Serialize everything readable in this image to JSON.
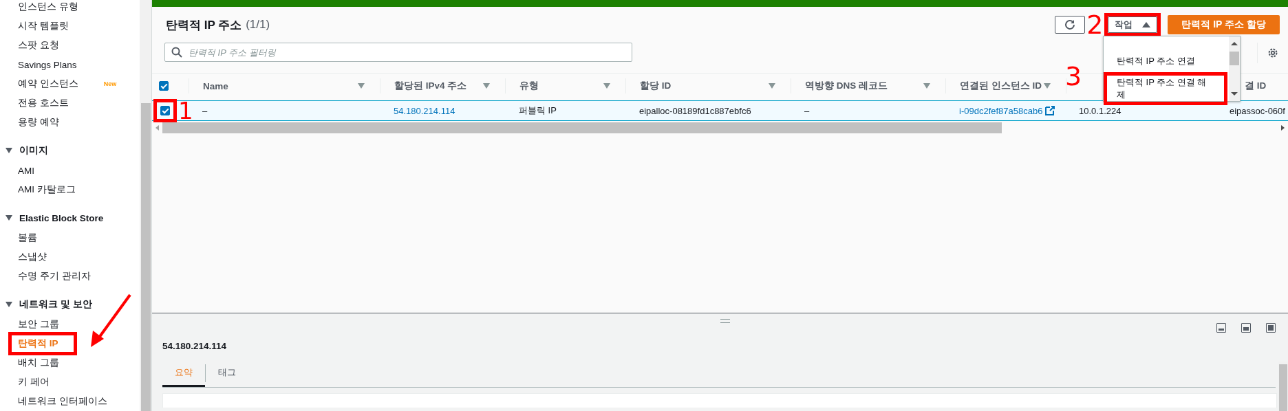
{
  "sidebar": {
    "sections": [
      {
        "items": [
          {
            "label": "인스턴스 유형",
            "selected": false
          },
          {
            "label": "시작 템플릿",
            "selected": false
          },
          {
            "label": "스팟 요청",
            "selected": false
          },
          {
            "label": "Savings Plans",
            "selected": false
          },
          {
            "label": "예약 인스턴스",
            "selected": false,
            "badge": "New"
          },
          {
            "label": "전용 호스트",
            "selected": false
          },
          {
            "label": "용량 예약",
            "selected": false
          }
        ]
      },
      {
        "title": "이미지",
        "expanded": true,
        "items": [
          {
            "label": "AMI",
            "selected": false
          },
          {
            "label": "AMI 카탈로그",
            "selected": false
          }
        ]
      },
      {
        "title": "Elastic Block Store",
        "expanded": true,
        "items": [
          {
            "label": "볼륨",
            "selected": false
          },
          {
            "label": "스냅샷",
            "selected": false
          },
          {
            "label": "수명 주기 관리자",
            "selected": false
          }
        ]
      },
      {
        "title": "네트워크 및 보안",
        "expanded": true,
        "items": [
          {
            "label": "보안 그룹",
            "selected": false
          },
          {
            "label": "탄력적 IP",
            "selected": true,
            "highlighted": true,
            "arrow": true
          },
          {
            "label": "배치 그룹",
            "selected": false
          },
          {
            "label": "키 페어",
            "selected": false
          },
          {
            "label": "네트워크 인터페이스",
            "selected": false
          }
        ]
      }
    ]
  },
  "table_panel": {
    "title": "탄력적 IP 주소",
    "count": "(1/1)",
    "actions_button": {
      "label": "작업",
      "expanded": true,
      "highlighted": true,
      "annotation": "2"
    },
    "primary_button": "탄력적 IP 주소 할당",
    "actions_menu": [
      {
        "label": "탄력적 IP 주소 연결",
        "highlighted": false
      },
      {
        "label": "탄력적 IP 주소 연결 해제",
        "highlighted": true,
        "annotation": "3"
      }
    ],
    "filter": {
      "placeholder": "탄력적 IP 주소 필터링"
    },
    "select_all_checked": true,
    "columns": [
      {
        "label": "Name",
        "sortable": true
      },
      {
        "label": "할당된 IPv4 주소",
        "sortable": true
      },
      {
        "label": "유형",
        "sortable": true
      },
      {
        "label": "할당 ID",
        "sortable": true
      },
      {
        "label": "역방향 DNS 레코드",
        "sortable": true
      },
      {
        "label": "연결된 인스턴스 ID",
        "sortable": true
      },
      {
        "sortable": false
      },
      {
        "label": "결 ID",
        "sortable": false
      }
    ],
    "rows": [
      {
        "checked": true,
        "selected": true,
        "highlighted": true,
        "annotation": "1",
        "cells": [
          {
            "text": "–",
            "kind": "text"
          },
          {
            "text": "54.180.214.114",
            "kind": "link"
          },
          {
            "text": "퍼블릭 IP",
            "kind": "text"
          },
          {
            "text": "eipalloc-08189fd1c887ebfc6",
            "kind": "text"
          },
          {
            "text": "–",
            "kind": "text"
          },
          {
            "text": "i-09dc2fef87a58cab6",
            "kind": "external_link"
          },
          {
            "text": "10.0.1.224",
            "kind": "text"
          },
          {
            "text": "eipassoc-060f",
            "kind": "text"
          }
        ]
      }
    ]
  },
  "details": {
    "title": "54.180.214.114",
    "tabs": [
      {
        "label": "요약",
        "selected": true
      },
      {
        "label": "태그",
        "selected": false
      }
    ]
  }
}
